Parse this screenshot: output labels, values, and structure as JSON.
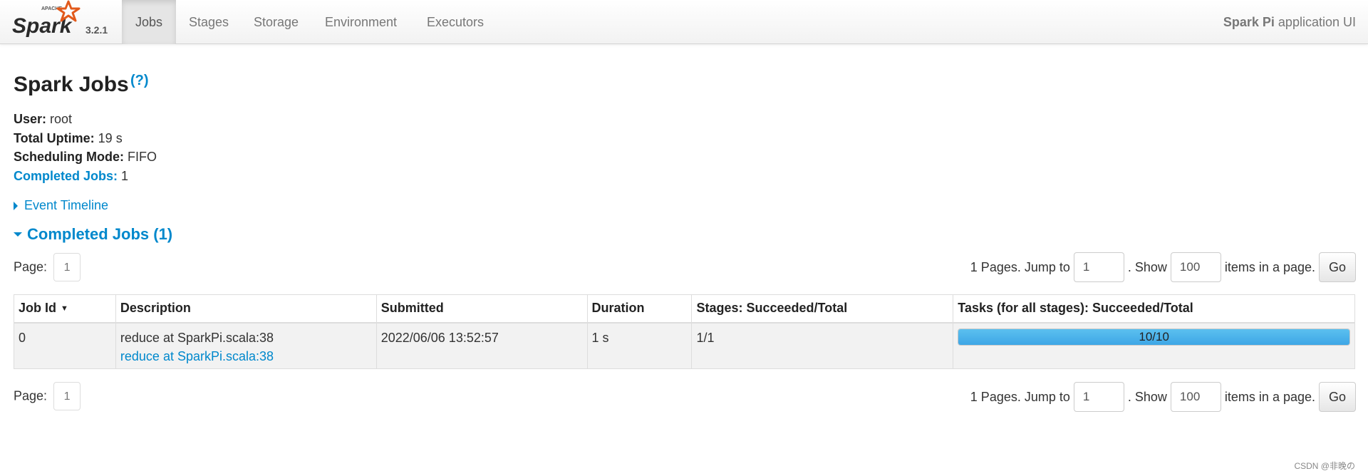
{
  "navbar": {
    "brand_version": "3.2.1",
    "tabs": [
      {
        "label": "Jobs",
        "active": true
      },
      {
        "label": "Stages"
      },
      {
        "label": "Storage"
      },
      {
        "label": "Environment"
      },
      {
        "label": "Executors"
      }
    ],
    "app_name_bold": "Spark Pi",
    "app_name_rest": " application UI"
  },
  "header": {
    "title": "Spark Jobs",
    "help": "(?)"
  },
  "summary": {
    "user_label": "User:",
    "user_value": " root",
    "uptime_label": "Total Uptime:",
    "uptime_value": " 19 s",
    "mode_label": "Scheduling Mode:",
    "mode_value": " FIFO",
    "completed_label": "Completed Jobs:",
    "completed_value": " 1"
  },
  "timeline": {
    "label": "Event Timeline"
  },
  "completed_section": {
    "label": "Completed Jobs (1)"
  },
  "pagination": {
    "page_label": "Page:",
    "current_page": "1",
    "pages_text": "1 Pages. Jump to",
    "jump_value": "1",
    "show_text": ". Show",
    "show_value": "100",
    "items_text": "items in a page.",
    "go_label": "Go"
  },
  "table": {
    "headers": {
      "job_id": "Job Id",
      "description": "Description",
      "submitted": "Submitted",
      "duration": "Duration",
      "stages": "Stages: Succeeded/Total",
      "tasks": "Tasks (for all stages): Succeeded/Total"
    },
    "rows": [
      {
        "job_id": "0",
        "description": "reduce at SparkPi.scala:38",
        "description_link": "reduce at SparkPi.scala:38",
        "submitted": "2022/06/06 13:52:57",
        "duration": "1 s",
        "stages": "1/1",
        "tasks_label": "10/10",
        "tasks_fraction": 1.0
      }
    ]
  },
  "colors": {
    "link": "#0088cc",
    "progress": "#3ea6e6"
  },
  "watermark": "CSDN @非晚の"
}
